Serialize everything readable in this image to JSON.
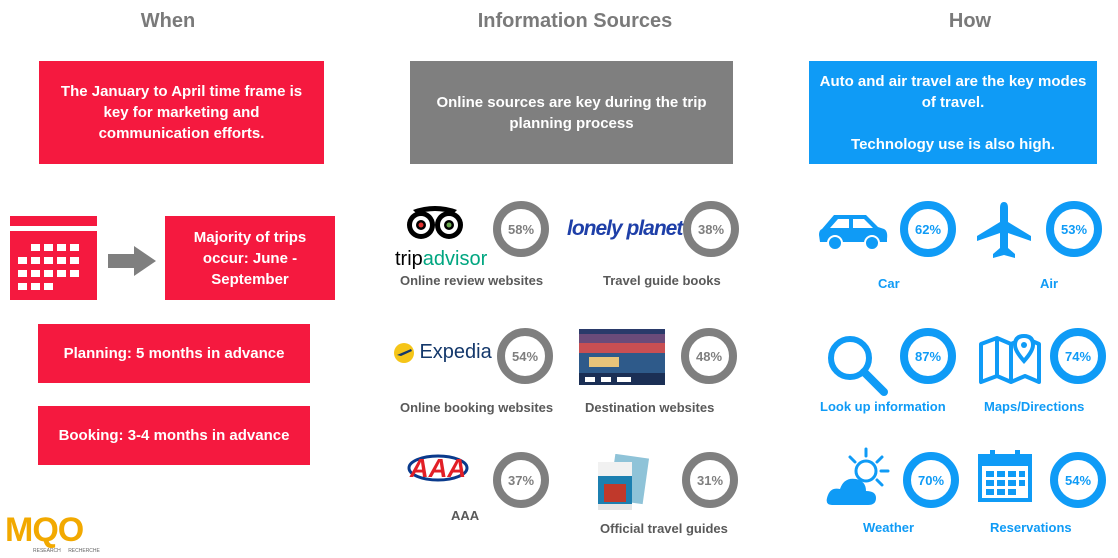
{
  "headings": {
    "when": "When",
    "sources": "Information Sources",
    "how": "How"
  },
  "when": {
    "box_top": "The January to April time frame is key for marketing and communication efforts.",
    "trips": "Majority of trips occur: June - September",
    "planning": "Planning: 5 months in advance",
    "booking": "Booking: 3-4 months in advance"
  },
  "sources": {
    "box_top": "Online sources are key during the trip planning process",
    "items": [
      {
        "logo": "tripadvisor",
        "pct": "58%",
        "label": "Online review websites"
      },
      {
        "logo": "lonely planet",
        "pct": "38%",
        "label": "Travel guide books"
      },
      {
        "logo": "Expedia",
        "pct": "54%",
        "label": "Online booking websites"
      },
      {
        "logo": "",
        "pct": "48%",
        "label": "Destination websites"
      },
      {
        "logo": "AAA",
        "pct": "37%",
        "label": "AAA"
      },
      {
        "logo": "",
        "pct": "31%",
        "label": "Official travel guides"
      }
    ]
  },
  "how": {
    "box_top": "Auto and air travel are the key modes of travel.\n\nTechnology use is also high.",
    "items": [
      {
        "icon": "car-icon",
        "pct": "62%",
        "label": "Car"
      },
      {
        "icon": "airplane-icon",
        "pct": "53%",
        "label": "Air"
      },
      {
        "icon": "magnifier-icon",
        "pct": "87%",
        "label": "Look up information"
      },
      {
        "icon": "map-icon",
        "pct": "74%",
        "label": "Maps/Directions"
      },
      {
        "icon": "weather-icon",
        "pct": "70%",
        "label": "Weather"
      },
      {
        "icon": "calendar-icon",
        "pct": "54%",
        "label": "Reservations"
      }
    ]
  },
  "brand": {
    "logo": "MQO",
    "sub_left": "RESEARCH",
    "sub_right": "RECHERCHE"
  },
  "colors": {
    "red": "#f5193f",
    "grey": "#7f7f7f",
    "blue": "#0f9bf6"
  }
}
